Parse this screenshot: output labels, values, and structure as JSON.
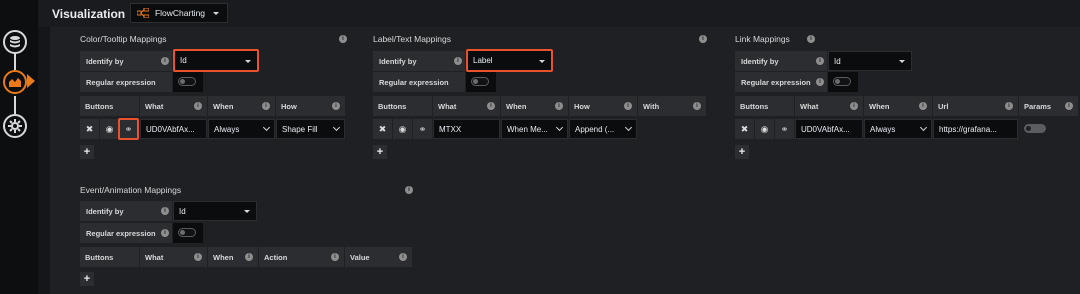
{
  "header": {
    "title": "Visualization",
    "picker": "FlowCharting"
  },
  "sidebar": {
    "items": [
      "queries-icon",
      "visualization-icon",
      "settings-icon"
    ]
  },
  "info": "i",
  "plus": "+",
  "color": {
    "title": "Color/Tooltip Mappings",
    "identify_label": "Identify by",
    "identify_value": "Id",
    "regex_label": "Regular expression",
    "columns": [
      "Buttons",
      "What",
      "When",
      "How"
    ],
    "row": {
      "what": "UD0VAbfAx...",
      "when": "Always",
      "how": "Shape Fill"
    }
  },
  "text": {
    "title": "Label/Text Mappings",
    "identify_label": "Identify by",
    "identify_value": "Label",
    "regex_label": "Regular expression",
    "columns": [
      "Buttons",
      "What",
      "When",
      "How",
      "With"
    ],
    "row": {
      "what": "MTXX",
      "when": "When Me...",
      "how": "Append (..."
    }
  },
  "link": {
    "title": "Link Mappings",
    "identify_label": "Identify by",
    "identify_value": "Id",
    "regex_label": "Regular expression",
    "columns": [
      "Buttons",
      "What",
      "When",
      "Url",
      "Params"
    ],
    "row": {
      "what": "UD0VAbfAx...",
      "when": "Always",
      "url": "https://grafana..."
    }
  },
  "event": {
    "title": "Event/Animation Mappings",
    "identify_label": "Identify by",
    "identify_value": "Id",
    "regex_label": "Regular expression",
    "columns": [
      "Buttons",
      "What",
      "When",
      "Action",
      "Value"
    ]
  },
  "colors": {
    "accent": "#eb7b18",
    "highlight": "#e8532e",
    "panel": "#1f2024"
  }
}
